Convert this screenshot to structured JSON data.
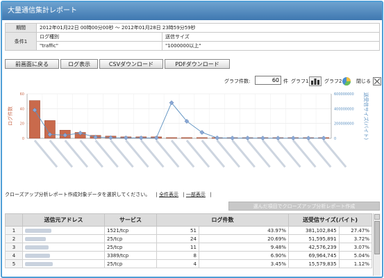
{
  "title": "大量通信集計レポート",
  "conditions": {
    "period_label": "期間",
    "period_value": "2012年01月22日 00時00分00秒 〜 2012年01月28日 23時59分59秒",
    "cond_label": "条件1",
    "log_type_label": "ログ種別",
    "log_type_value": "\"traffic\"",
    "send_size_label": "送信サイズ",
    "send_size_value": "\"1000000以上\""
  },
  "buttons": {
    "back": "前画面に戻る",
    "log_display": "ログ表示",
    "csv_download": "CSVダウンロード",
    "pdf_download": "PDFダウンロード"
  },
  "graph_controls": {
    "count_label": "グラフ件数:",
    "count_value": "60",
    "count_unit": "件",
    "graph1_label": "グラフ1",
    "graph2_label": "グラフ2",
    "close_label": "閉じる"
  },
  "chart_data": {
    "type": "bar",
    "ylabel_left": "ログ件数",
    "ylabel_right": "送受信サイズ(バイト)",
    "y_ticks_left": [
      "0",
      "20",
      "40",
      "60"
    ],
    "y_ticks_right": [
      "0",
      "200000000",
      "400000000",
      "600000000"
    ],
    "ylim_left": [
      0,
      60
    ],
    "ylim_right": [
      0,
      600000000
    ],
    "categories": [
      "1",
      "2",
      "3",
      "4",
      "5",
      "6",
      "7",
      "8",
      "9",
      "10",
      "11",
      "12",
      "13",
      "14",
      "15",
      "16",
      "17",
      "18",
      "19",
      "20"
    ],
    "series": [
      {
        "values": [
          51,
          24,
          11,
          8,
          4,
          3,
          2,
          2,
          2,
          1,
          1,
          1,
          1,
          1,
          1,
          1,
          1,
          1,
          1,
          1
        ]
      },
      {
        "values": [
          381102845,
          51595891,
          42576239,
          69964745,
          15579835,
          8000000,
          6000000,
          5000000,
          5000000,
          480000000,
          230000000,
          80000000,
          5000000,
          3000000,
          3000000,
          2000000,
          2000000,
          2000000,
          2000000,
          2000000
        ]
      }
    ],
    "colors": {
      "bar": "#c96a4c",
      "line": "#5a8fc0",
      "marker": "#8aa8d6"
    }
  },
  "info": {
    "message": "クローズアップ分析レポート作成対象データを選択してください。",
    "show_all": "全件表示",
    "show_partial": "一部表示",
    "separator": "|"
  },
  "create_button": "選んだ項目でクローズアップ分析レポート作成",
  "table": {
    "headers": [
      "送信元アドレス",
      "サービス",
      "ログ件数",
      "送受信サイズ(バイト)"
    ],
    "rows": [
      {
        "idx": "1",
        "service": "1521/tcp",
        "count": "51",
        "count_pct": "43.97%",
        "size": "381,102,845",
        "size_pct": "27.47%"
      },
      {
        "idx": "2",
        "service": "25/tcp",
        "count": "24",
        "count_pct": "20.69%",
        "size": "51,595,891",
        "size_pct": "3.72%"
      },
      {
        "idx": "3",
        "service": "25/tcp",
        "count": "11",
        "count_pct": "9.48%",
        "size": "42,576,239",
        "size_pct": "3.07%"
      },
      {
        "idx": "4",
        "service": "3389/tcp",
        "count": "8",
        "count_pct": "6.90%",
        "size": "69,964,745",
        "size_pct": "5.04%"
      },
      {
        "idx": "5",
        "service": "25/tcp",
        "count": "4",
        "count_pct": "3.45%",
        "size": "15,579,835",
        "size_pct": "1.12%"
      }
    ]
  }
}
